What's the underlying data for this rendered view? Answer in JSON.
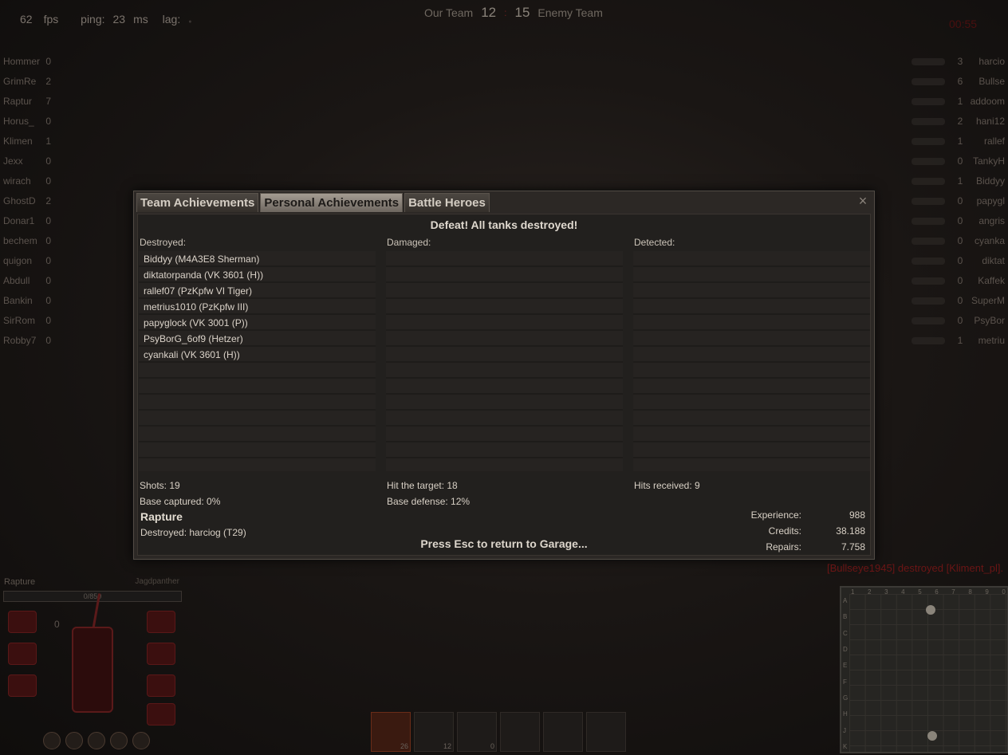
{
  "hud": {
    "fps_value": "62",
    "fps_label": "fps",
    "ping_label": "ping:",
    "ping_value": "23",
    "ping_unit": "ms",
    "lag_label": "lag:",
    "timer": "00:55"
  },
  "scoreboard": {
    "our_team_label": "Our Team",
    "our_score": "12",
    "separator": ":",
    "enemy_score": "15",
    "enemy_team_label": "Enemy Team"
  },
  "team_left": [
    {
      "name": "Hommer",
      "score": "0"
    },
    {
      "name": "GrimRe",
      "score": "2"
    },
    {
      "name": "Raptur",
      "score": "7"
    },
    {
      "name": "Horus_",
      "score": "0"
    },
    {
      "name": "Klimen",
      "score": "1"
    },
    {
      "name": "Jexx",
      "score": "0"
    },
    {
      "name": "wirach",
      "score": "0"
    },
    {
      "name": "GhostD",
      "score": "2"
    },
    {
      "name": "Donar1",
      "score": "0"
    },
    {
      "name": "bechem",
      "score": "0"
    },
    {
      "name": "quigon",
      "score": "0"
    },
    {
      "name": "Abdull",
      "score": "0"
    },
    {
      "name": "Bankin",
      "score": "0"
    },
    {
      "name": "SirRom",
      "score": "0"
    },
    {
      "name": "Robby7",
      "score": "0"
    }
  ],
  "team_right": [
    {
      "name": "harcio",
      "score": "3"
    },
    {
      "name": "Bullse",
      "score": "6"
    },
    {
      "name": "addoom",
      "score": "1"
    },
    {
      "name": "hani12",
      "score": "2"
    },
    {
      "name": "rallef",
      "score": "1"
    },
    {
      "name": "TankyH",
      "score": "0"
    },
    {
      "name": "Biddyy",
      "score": "1"
    },
    {
      "name": "papygl",
      "score": "0"
    },
    {
      "name": "angris",
      "score": "0"
    },
    {
      "name": "cyanka",
      "score": "0"
    },
    {
      "name": "diktat",
      "score": "0"
    },
    {
      "name": "Kaffek",
      "score": "0"
    },
    {
      "name": "SuperM",
      "score": "0"
    },
    {
      "name": "PsyBor",
      "score": "0"
    },
    {
      "name": "metriu",
      "score": "1"
    }
  ],
  "dialog": {
    "tabs": [
      "Team Achievements",
      "Personal Achievements",
      "Battle Heroes"
    ],
    "close_icon": "close-icon",
    "headline": "Defeat! All tanks destroyed!",
    "destroyed_label": "Destroyed:",
    "damaged_label": "Damaged:",
    "detected_label": "Detected:",
    "destroyed": [
      "Biddyy (M4A3E8 Sherman)",
      "diktatorpanda (VK 3601 (H))",
      "rallef07 (PzKpfw VI Tiger)",
      "metrius1010 (PzKpfw III)",
      "papyglock (VK 3001 (P))",
      "PsyBorG_6of9 (Hetzer)",
      "cyankali (VK 3601 (H))"
    ],
    "shots": "Shots: 19",
    "hit_target": "Hit the target: 18",
    "hits_received": "Hits received: 9",
    "base_captured": "Base captured: 0%",
    "base_defense": "Base defense: 12%",
    "player_name": "Rapture",
    "destroyed_by": "Destroyed: harciog (T29)",
    "esc_message": "Press Esc to return to Garage...",
    "experience_label": "Experience:",
    "experience_value": "988",
    "credits_label": "Credits:",
    "credits_value": "38.188",
    "repairs_label": "Repairs:",
    "repairs_value": "7.758"
  },
  "chat": {
    "kill_message": "[Bullseye1945] destroyed [Kliment_pl]."
  },
  "tank_panel": {
    "player": "Rapture",
    "tank": "Jagdpanther",
    "hp": "0/850",
    "speed": "0"
  },
  "ammo": [
    {
      "icon": "shell-ap-icon",
      "count": "26"
    },
    {
      "icon": "shell-apcr-icon",
      "count": "12"
    },
    {
      "icon": "shell-he-icon",
      "count": "0"
    },
    {
      "icon": "repair-kit-icon",
      "count": ""
    },
    {
      "icon": "first-aid-kit-icon",
      "count": ""
    },
    {
      "icon": "fire-extinguisher-icon",
      "count": ""
    }
  ],
  "minimap": {
    "cols": [
      "1",
      "2",
      "3",
      "4",
      "5",
      "6",
      "7",
      "8",
      "9",
      "0"
    ],
    "rows": [
      "A",
      "B",
      "C",
      "D",
      "E",
      "F",
      "G",
      "H",
      "J",
      "K"
    ]
  }
}
